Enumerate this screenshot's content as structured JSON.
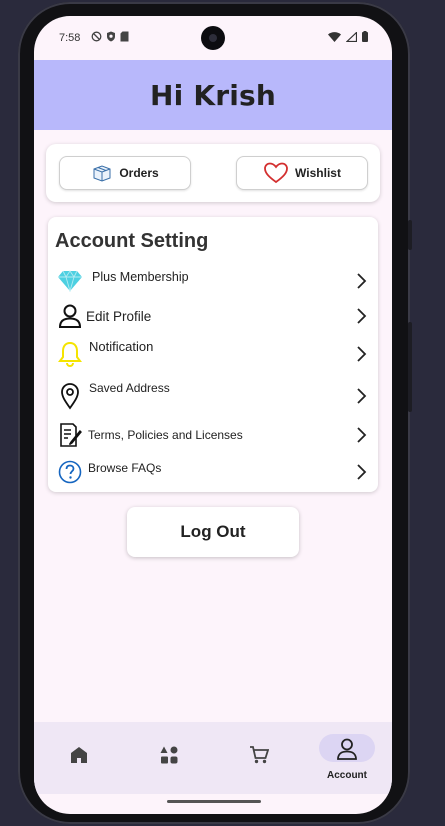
{
  "status_bar": {
    "time": "7:58"
  },
  "header": {
    "greeting": "Hi Krish"
  },
  "quick_actions": {
    "orders_label": "Orders",
    "wishlist_label": "Wishlist"
  },
  "account_setting": {
    "title": "Account Setting",
    "items": [
      {
        "label": "Plus Membership",
        "icon": "diamond-icon"
      },
      {
        "label": "Edit Profile",
        "icon": "person-icon"
      },
      {
        "label": "Notification",
        "icon": "bell-icon"
      },
      {
        "label": "Saved Address",
        "icon": "location-pin-icon"
      },
      {
        "label": "Terms, Policies and Licenses",
        "icon": "document-edit-icon"
      },
      {
        "label": "Browse FAQs",
        "icon": "help-circle-icon"
      }
    ]
  },
  "logout_label": "Log Out",
  "bottom_nav": {
    "items": [
      {
        "icon": "home-icon",
        "label": ""
      },
      {
        "icon": "grid-icon",
        "label": ""
      },
      {
        "icon": "cart-icon",
        "label": ""
      },
      {
        "icon": "account-icon",
        "label": "Account"
      }
    ]
  },
  "colors": {
    "header_bg": "#b8b8fb",
    "screen_bg": "#fdf4fb",
    "nav_bg": "#efe7f5",
    "active_pill": "#dcd5f3",
    "heart": "#d32f2f",
    "bell": "#f5e400",
    "diamond": "#4dd0e1",
    "help": "#1565c0"
  }
}
